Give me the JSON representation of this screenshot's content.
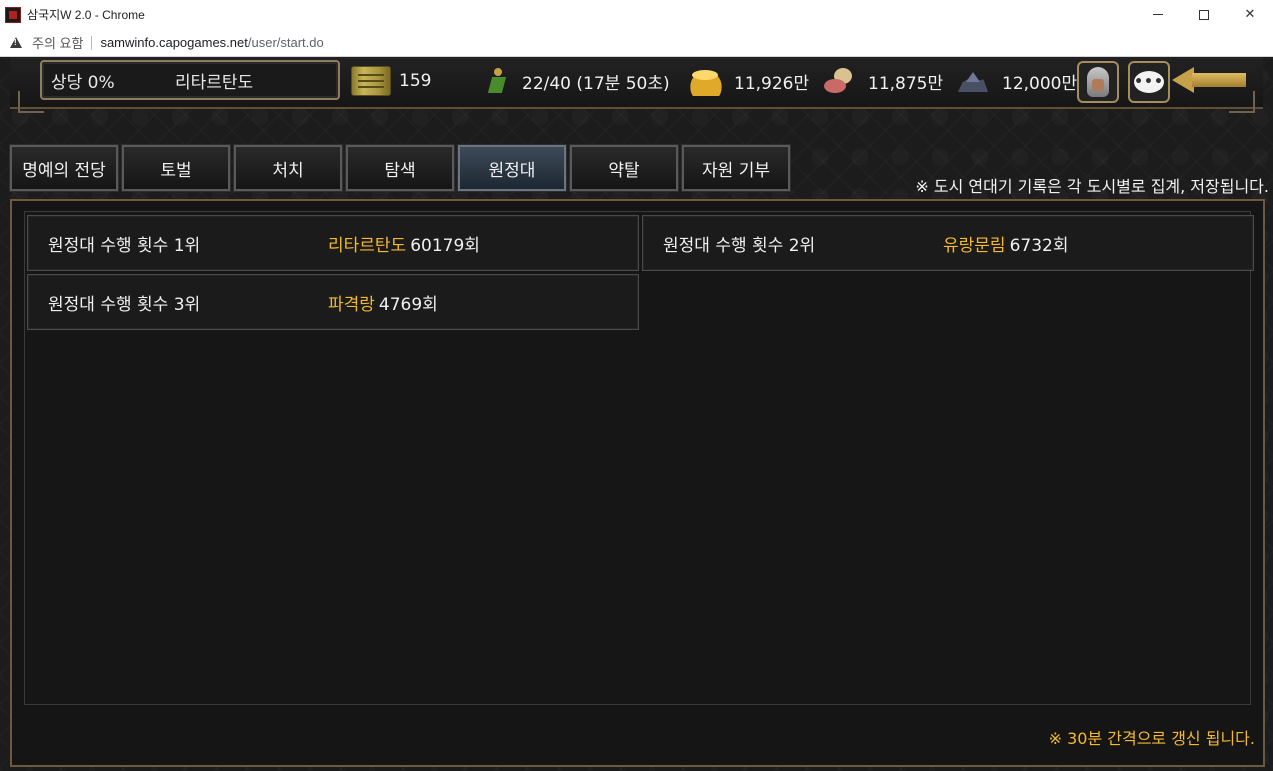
{
  "browser": {
    "window_title": "삼국지W 2.0 - Chrome",
    "security_label": "주의 요함",
    "url_host": "samwinfo.capogames.net",
    "url_path": "/user/start.do"
  },
  "topbar": {
    "profile": {
      "rank": "상당 0%",
      "name": "리타르탄도"
    },
    "resources": {
      "scroll": "159",
      "stamina": "22/40 (17분 50초)",
      "gold": "11,926만",
      "food": "11,875만",
      "ore": "12,000만"
    }
  },
  "tabs": [
    {
      "label": "명예의 전당"
    },
    {
      "label": "토벌"
    },
    {
      "label": "처치"
    },
    {
      "label": "탐색"
    },
    {
      "label": "원정대",
      "active": true
    },
    {
      "label": "약탈"
    },
    {
      "label": "자원 기부"
    }
  ],
  "notice_top": "※ 도시 연대기 기록은 각 도시별로 집계, 저장됩니다.",
  "rankings": [
    {
      "label": "원정대 수행 횟수 1위",
      "name": "리타르탄도",
      "count": "60179회"
    },
    {
      "label": "원정대 수행 횟수 2위",
      "name": "유랑문림",
      "count": "6732회"
    },
    {
      "label": "원정대 수행 횟수 3위",
      "name": "파격랑",
      "count": "4769회"
    }
  ],
  "notice_bottom": "※ 30분 간격으로 갱신 됩니다.",
  "colors": {
    "highlight": "#f4b92c",
    "panel_border": "#6b5a3e",
    "background": "#1c1c1c"
  }
}
